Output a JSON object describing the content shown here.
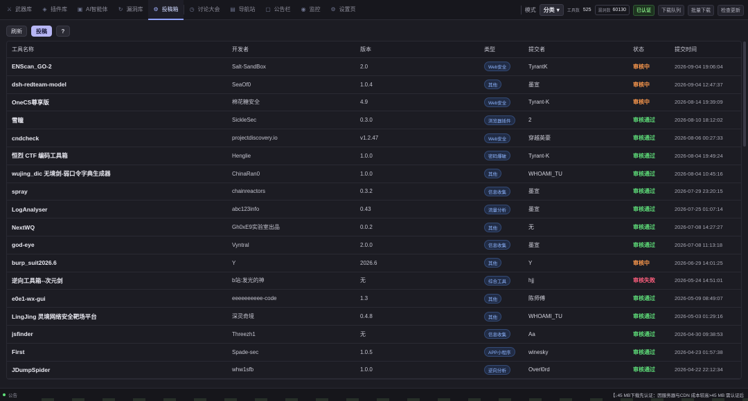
{
  "nav": {
    "tabs": [
      {
        "label": "武器库",
        "icon": "sword-icon"
      },
      {
        "label": "插件库",
        "icon": "plugin-icon"
      },
      {
        "label": "AI智能体",
        "icon": "ai-icon"
      },
      {
        "label": "漏洞库",
        "icon": "bug-icon"
      },
      {
        "label": "投稿箱",
        "icon": "inbox-icon"
      },
      {
        "label": "讨论大会",
        "icon": "chat-icon"
      },
      {
        "label": "导航站",
        "icon": "compass-icon"
      },
      {
        "label": "公告栏",
        "icon": "bulletin-icon"
      },
      {
        "label": "监控",
        "icon": "monitor-icon"
      },
      {
        "label": "设置页",
        "icon": "settings-icon"
      }
    ],
    "active_index": 4
  },
  "header": {
    "mode_label": "模式",
    "mode_value": "分类",
    "tools_label": "工具数",
    "tools_value": "525",
    "exploits_label": "漏洞数",
    "exploits_value": "60130",
    "verified_label": "已认证",
    "download_queue": "下载队列",
    "batch_download": "批量下载",
    "batch_update": "检查更新"
  },
  "toolbar": {
    "refresh": "刷新",
    "submit": "投稿",
    "help": "?"
  },
  "table": {
    "headers": {
      "name": "工具名称",
      "developer": "开发者",
      "version": "版本",
      "type": "类型",
      "submitter": "提交者",
      "status": "状态",
      "time": "提交时间"
    },
    "rows": [
      {
        "name": "ENScan_GO-2",
        "developer": "Salt-SandBox",
        "version": "2.0",
        "type": "Web安全",
        "submitter": "TyrantK",
        "status": "审核中",
        "status_kind": "pending",
        "time": "2026-09-04 19:06:04"
      },
      {
        "name": "dsh-redteam-model",
        "developer": "SeaOf0",
        "version": "1.0.4",
        "type": "其他",
        "submitter": "墨宣",
        "status": "审核中",
        "status_kind": "pending",
        "time": "2026-09-04 12:47:37"
      },
      {
        "name": "OneCS尊享版",
        "developer": "棉花糖安全",
        "version": "4.9",
        "type": "Web安全",
        "submitter": "Tyrant-K",
        "status": "审核中",
        "status_kind": "pending",
        "time": "2026-08-14 19:39:09"
      },
      {
        "name": "雪瞳",
        "developer": "SickleSec",
        "version": "0.3.0",
        "type": "浏览器插件",
        "submitter": "2",
        "status": "审核通过",
        "status_kind": "approved",
        "time": "2026-08-10 18:12:02"
      },
      {
        "name": "cndcheck",
        "developer": "projectdiscovery.io",
        "version": "v1.2.47",
        "type": "Web安全",
        "submitter": "穿越英豪",
        "status": "审核通过",
        "status_kind": "approved",
        "time": "2026-08-06 00:27:33"
      },
      {
        "name": "恒烈 CTF 编码工具箱",
        "developer": "Henglie",
        "version": "1.0.0",
        "type": "密码爆破",
        "submitter": "Tyrant-K",
        "status": "审核通过",
        "status_kind": "approved",
        "time": "2026-08-04 19:49:24"
      },
      {
        "name": "wujing_dic 无境剑-弱口令字典生成器",
        "developer": "ChinaRan0",
        "version": "1.0.0",
        "type": "其他",
        "submitter": "WHOAMI_TU",
        "status": "审核通过",
        "status_kind": "approved",
        "time": "2026-08-04 10:45:16"
      },
      {
        "name": "spray",
        "developer": "chainreactors",
        "version": "0.3.2",
        "type": "信息收集",
        "submitter": "墨宣",
        "status": "审核通过",
        "status_kind": "approved",
        "time": "2026-07-29 23:20:15"
      },
      {
        "name": "LogAnalyser",
        "developer": "abc123info",
        "version": "0.43",
        "type": "流量分析",
        "submitter": "墨宣",
        "status": "审核通过",
        "status_kind": "approved",
        "time": "2026-07-25 01:07:14"
      },
      {
        "name": "NextWQ",
        "developer": "Gh0xE9实验室出品",
        "version": "0.0.2",
        "type": "其他",
        "submitter": "无",
        "status": "审核通过",
        "status_kind": "approved",
        "time": "2026-07-08 14:27:27"
      },
      {
        "name": "god-eye",
        "developer": "Vyntral",
        "version": "2.0.0",
        "type": "信息收集",
        "submitter": "墨宣",
        "status": "审核通过",
        "status_kind": "approved",
        "time": "2026-07-08 11:13:18"
      },
      {
        "name": "burp_suit2026.6",
        "developer": "Y",
        "version": "2026.6",
        "type": "其他",
        "submitter": "Y",
        "status": "审核中",
        "status_kind": "pending",
        "time": "2026-06-29 14:01:25"
      },
      {
        "name": "逆向工具箱--次元剑",
        "developer": "b站:发光的神",
        "version": "无",
        "type": "综合工具",
        "submitter": "hjj",
        "status": "审核失败",
        "status_kind": "rejected",
        "time": "2026-05-24 14:51:01"
      },
      {
        "name": "e0e1-wx-gui",
        "developer": "eeeeeeeeee-code",
        "version": "1.3",
        "type": "其他",
        "submitter": "陈师傅",
        "status": "审核通过",
        "status_kind": "approved",
        "time": "2026-05-09 08:49:07"
      },
      {
        "name": "LingJing 灵境网络安全靶场平台",
        "developer": "深灵奇境",
        "version": "0.4.8",
        "type": "其他",
        "submitter": "WHOAMI_TU",
        "status": "审核通过",
        "status_kind": "approved",
        "time": "2026-05-03 01:29:16"
      },
      {
        "name": "jsfinder",
        "developer": "Threezh1",
        "version": "无",
        "type": "信息收集",
        "submitter": "Aa",
        "status": "审核通过",
        "status_kind": "approved",
        "time": "2026-04-30 09:38:53"
      },
      {
        "name": "First",
        "developer": "Spade-sec",
        "version": "1.0.5",
        "type": "APP小程序",
        "submitter": "winesky",
        "status": "审核通过",
        "status_kind": "approved",
        "time": "2026-04-23 01:57:38"
      },
      {
        "name": "JDumpSpider",
        "developer": "whw1sfb",
        "version": "1.0.0",
        "type": "逆向分析",
        "submitter": "Overl0rd",
        "status": "审核通过",
        "status_kind": "approved",
        "time": "2026-04-22 22:12:34"
      }
    ]
  },
  "footer": {
    "notice_label": "公告",
    "marquee": "【↓45 MB下载先认证：因服务器与CDN 成本较高>45 MB 需认证后"
  },
  "colors": {
    "accent": "#8fa2ff",
    "primary_button": "#b7b6f4",
    "pending": "#ff9a4d",
    "approved": "#5fe07a",
    "rejected": "#ff5f7e"
  }
}
